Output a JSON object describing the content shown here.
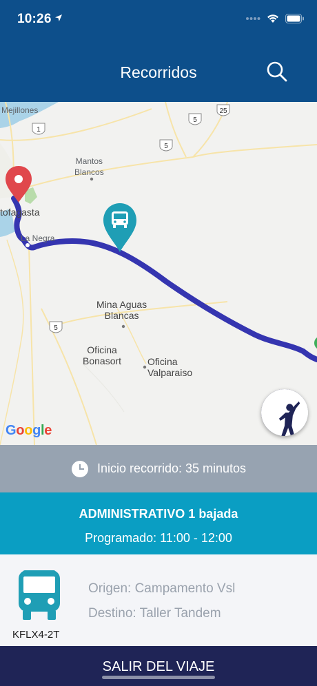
{
  "status": {
    "time": "10:26"
  },
  "nav": {
    "title": "Recorridos"
  },
  "map": {
    "places": {
      "mejillones": "Mejillones",
      "mantos_blancos": "Mantos\nBlancos",
      "antofagasta": "tofagasta",
      "la_negra": "La Negra",
      "mina_aguas_blancas": "Mina Aguas\nBlancas",
      "oficina_bonasort": "Oficina\nBonasort",
      "oficina_valparaiso": "Oficina\nValparaiso"
    },
    "route_shields": [
      "1",
      "5",
      "5",
      "25",
      "5"
    ],
    "attribution": "Google",
    "route_color": "#3535b0",
    "origin_pin_color": "#e0474c",
    "bus_pin_color": "#1f9eb5"
  },
  "trip": {
    "start_text": "Inicio recorrido: 35 minutos",
    "route_name": "ADMINISTRATIVO 1 bajada",
    "schedule": "Programado: 11:00 - 12:00",
    "plate": "KFLX4-2T",
    "origin": "Origen: Campamento Vsl",
    "destination": "Destino: Taller Tandem"
  },
  "actions": {
    "exit_label": "SALIR DEL VIAJE"
  },
  "colors": {
    "header": "#0d4f8b",
    "start_bar": "#97a3b1",
    "route_block": "#0a9ec3",
    "exit_button": "#1f2456"
  }
}
